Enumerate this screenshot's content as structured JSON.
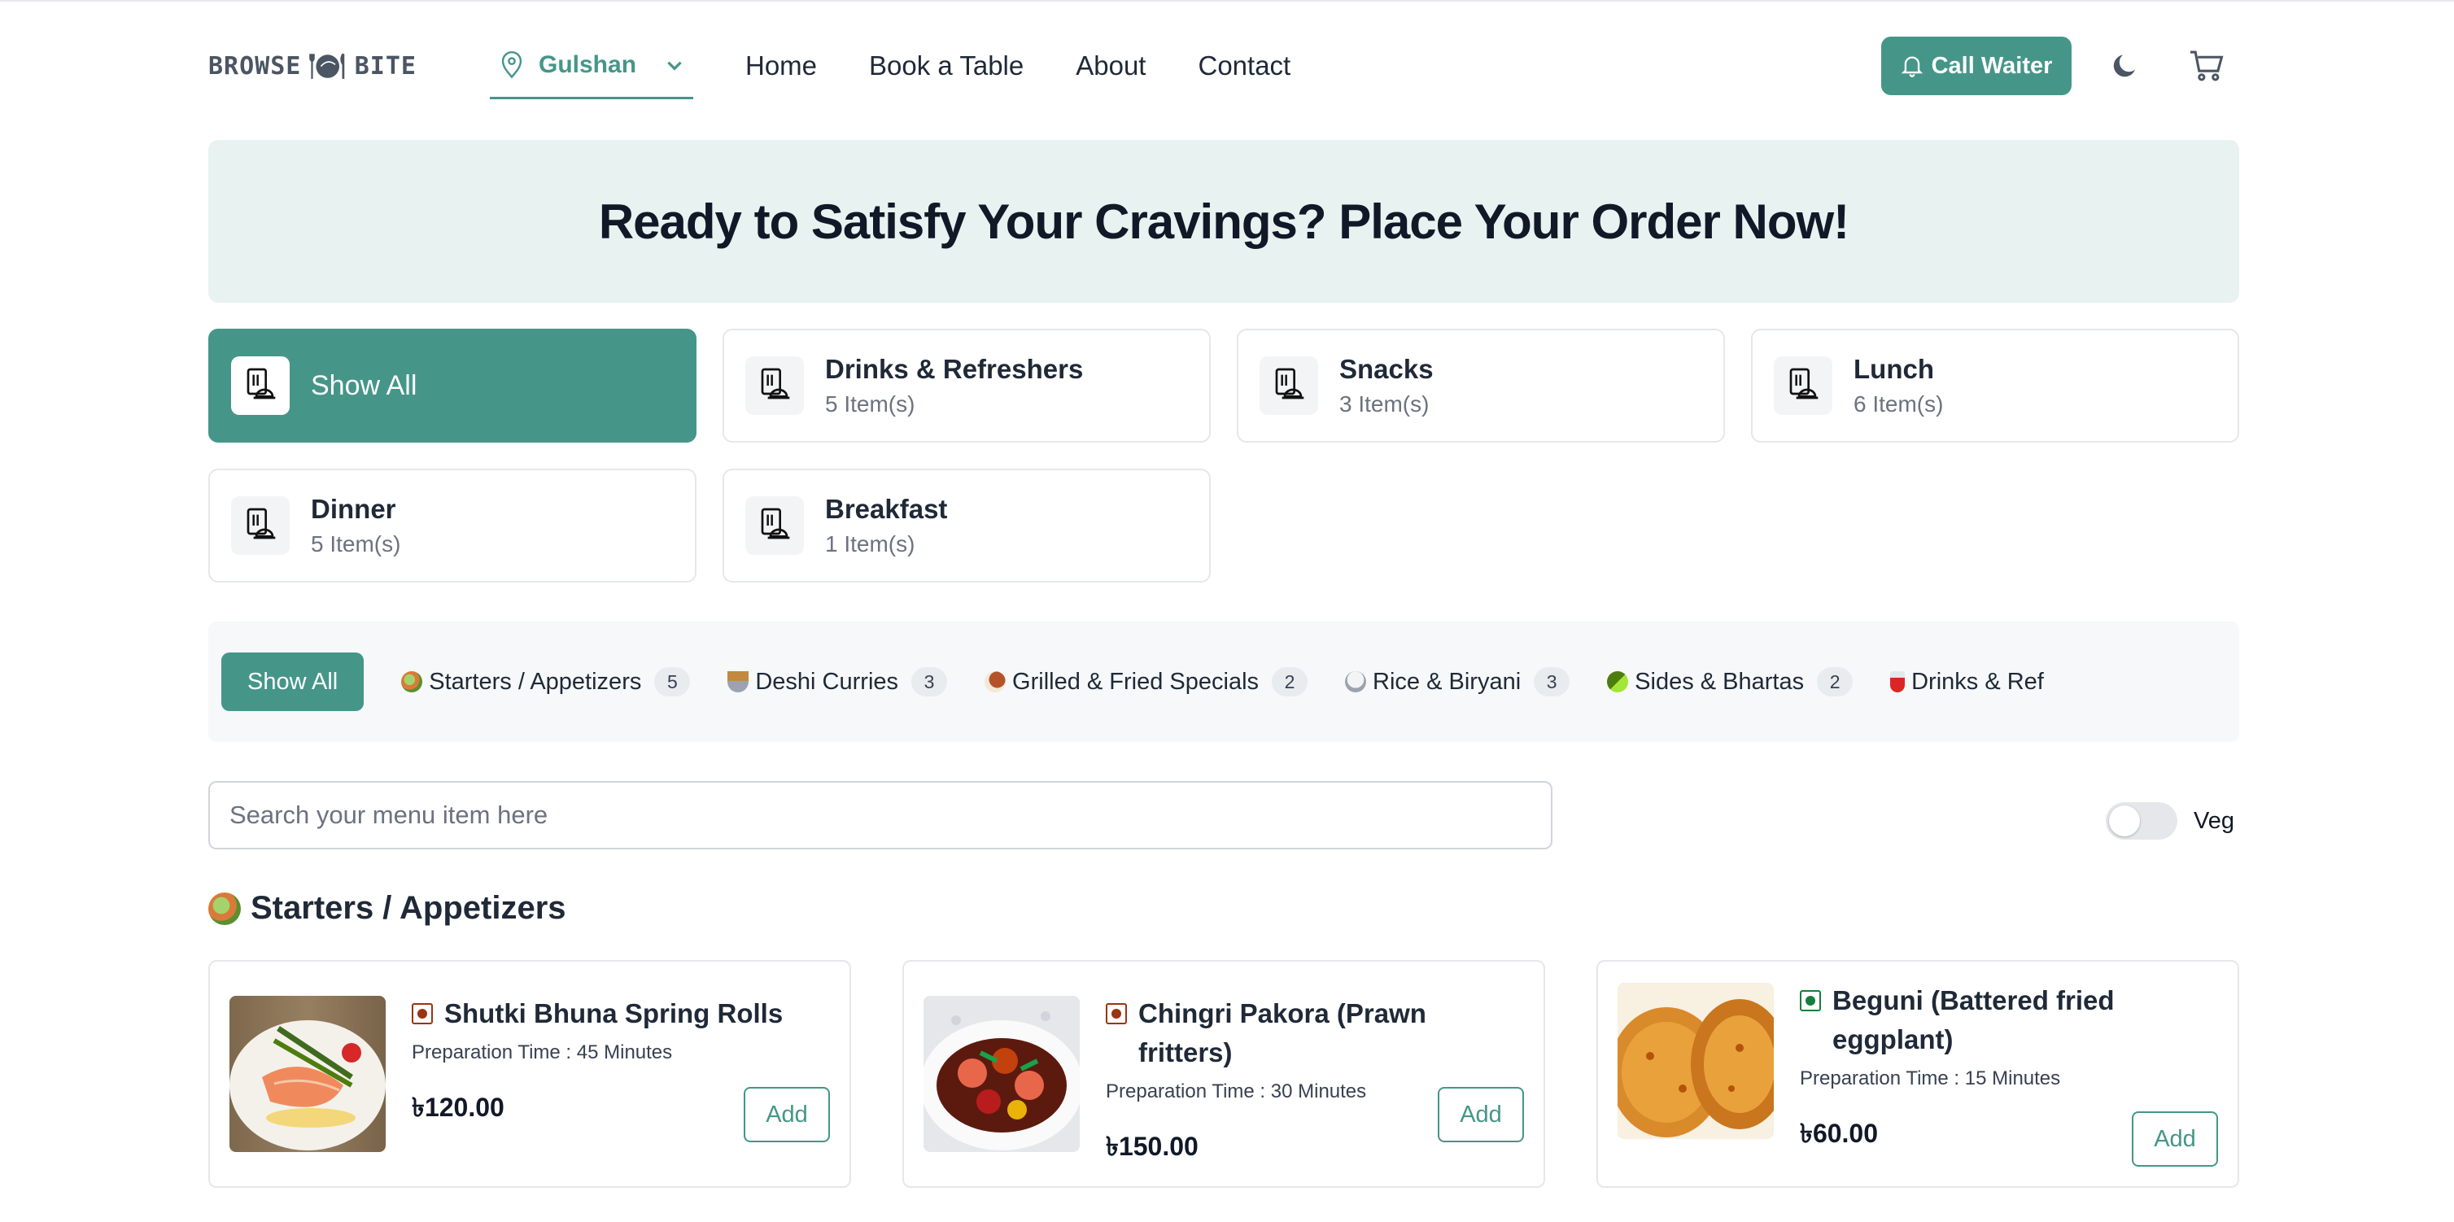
{
  "header": {
    "logo_left": "BROWSE",
    "logo_right": "BITE",
    "location": "Gulshan",
    "nav": [
      "Home",
      "Book a Table",
      "About",
      "Contact"
    ],
    "call_waiter": "Call Waiter"
  },
  "banner": {
    "title": "Ready to Satisfy Your Cravings? Place Your Order Now!"
  },
  "categories": [
    {
      "name": "Show All",
      "count": ""
    },
    {
      "name": "Drinks & Refreshers",
      "count": "5 Item(s)"
    },
    {
      "name": "Snacks",
      "count": "3 Item(s)"
    },
    {
      "name": "Lunch",
      "count": "6 Item(s)"
    },
    {
      "name": "Dinner",
      "count": "5 Item(s)"
    },
    {
      "name": "Breakfast",
      "count": "1 Item(s)"
    }
  ],
  "subcategories": {
    "all_label": "Show All",
    "items": [
      {
        "label": "Starters / Appetizers",
        "count": "5"
      },
      {
        "label": "Deshi Curries",
        "count": "3"
      },
      {
        "label": "Grilled & Fried Specials",
        "count": "2"
      },
      {
        "label": "Rice & Biryani",
        "count": "3"
      },
      {
        "label": "Sides & Bhartas",
        "count": "2"
      },
      {
        "label": "Drinks & Ref",
        "count": ""
      }
    ]
  },
  "search": {
    "placeholder": "Search your menu item here"
  },
  "veg_toggle": {
    "label": "Veg"
  },
  "section": {
    "title": "Starters / Appetizers"
  },
  "menu_items": [
    {
      "name": "Shutki Bhuna Spring Rolls",
      "prep": "Preparation Time : 45 Minutes",
      "price": "৳120.00",
      "add": "Add"
    },
    {
      "name": "Chingri Pakora (Prawn fritters)",
      "prep": "Preparation Time : 30 Minutes",
      "price": "৳150.00",
      "add": "Add"
    },
    {
      "name": "Beguni (Battered fried eggplant)",
      "prep": "Preparation Time : 15 Minutes",
      "price": "৳60.00",
      "add": "Add"
    }
  ]
}
